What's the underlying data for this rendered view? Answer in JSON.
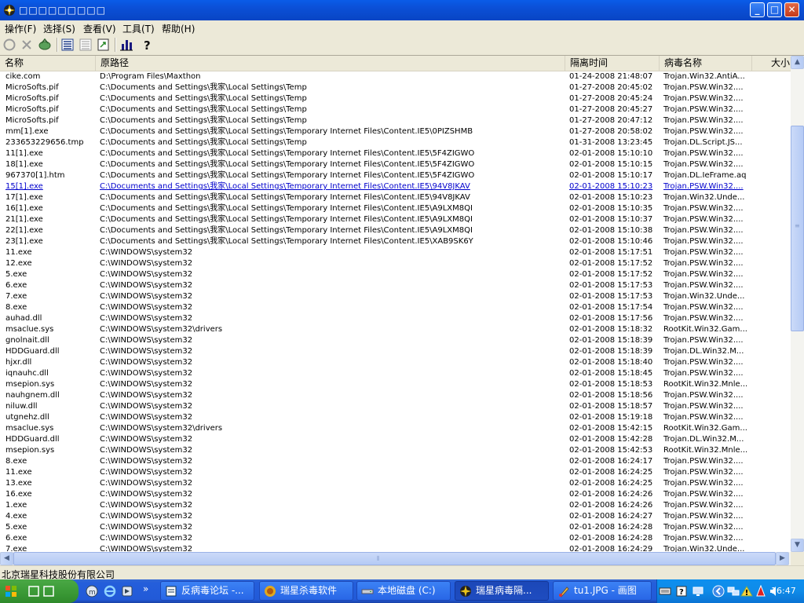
{
  "window": {
    "title": "□□□□□□□□□",
    "controls": {
      "minimize": "_",
      "maximize": "□",
      "close": "✕"
    }
  },
  "menu": [
    {
      "label": "操作(F)"
    },
    {
      "label": "选择(S)"
    },
    {
      "label": "查看(V)"
    },
    {
      "label": "工具(T)"
    },
    {
      "label": "帮助(H)"
    }
  ],
  "toolbar": {
    "icons": [
      "refresh-icon",
      "delete-icon",
      "restore-icon",
      "details-view-icon",
      "list-view-icon",
      "export-icon",
      "chart-icon",
      "help-icon"
    ]
  },
  "table": {
    "columns": [
      "名称",
      "原路径",
      "隔离时间",
      "病毒名称",
      "大小"
    ],
    "rows": [
      [
        "cike.com",
        "D:\\Program Files\\Maxthon",
        "01-24-2008 21:48:07",
        "Trojan.Win32.AntiA..."
      ],
      [
        "MicroSofts.pif",
        "C:\\Documents and Settings\\我家\\Local Settings\\Temp",
        "01-27-2008 20:45:02",
        "Trojan.PSW.Win32...."
      ],
      [
        "MicroSofts.pif",
        "C:\\Documents and Settings\\我家\\Local Settings\\Temp",
        "01-27-2008 20:45:24",
        "Trojan.PSW.Win32...."
      ],
      [
        "MicroSofts.pif",
        "C:\\Documents and Settings\\我家\\Local Settings\\Temp",
        "01-27-2008 20:45:27",
        "Trojan.PSW.Win32...."
      ],
      [
        "MicroSofts.pif",
        "C:\\Documents and Settings\\我家\\Local Settings\\Temp",
        "01-27-2008 20:47:12",
        "Trojan.PSW.Win32...."
      ],
      [
        "mm[1].exe",
        "C:\\Documents and Settings\\我家\\Local Settings\\Temporary Internet Files\\Content.IE5\\0PIZSHMB",
        "01-27-2008 20:58:02",
        "Trojan.PSW.Win32...."
      ],
      [
        "233653229656.tmp",
        "C:\\Documents and Settings\\我家\\Local Settings\\Temp",
        "01-31-2008 13:23:45",
        "Trojan.DL.Script.JS..."
      ],
      [
        "11[1].exe",
        "C:\\Documents and Settings\\我家\\Local Settings\\Temporary Internet Files\\Content.IE5\\5F4ZIGWO",
        "02-01-2008 15:10:10",
        "Trojan.PSW.Win32...."
      ],
      [
        "18[1].exe",
        "C:\\Documents and Settings\\我家\\Local Settings\\Temporary Internet Files\\Content.IE5\\5F4ZIGWO",
        "02-01-2008 15:10:15",
        "Trojan.PSW.Win32...."
      ],
      [
        "967370[1].htm",
        "C:\\Documents and Settings\\我家\\Local Settings\\Temporary Internet Files\\Content.IE5\\5F4ZIGWO",
        "02-01-2008 15:10:17",
        "Trojan.DL.IeFrame.aq"
      ],
      [
        "15[1].exe",
        "C:\\Documents and Settings\\我家\\Local Settings\\Temporary Internet Files\\Content.IE5\\94V8JKAV",
        "02-01-2008 15:10:23",
        "Trojan.PSW.Win32...."
      ],
      [
        "17[1].exe",
        "C:\\Documents and Settings\\我家\\Local Settings\\Temporary Internet Files\\Content.IE5\\94V8JKAV",
        "02-01-2008 15:10:23",
        "Trojan.Win32.Unde..."
      ],
      [
        "16[1].exe",
        "C:\\Documents and Settings\\我家\\Local Settings\\Temporary Internet Files\\Content.IE5\\A9LXM8QI",
        "02-01-2008 15:10:35",
        "Trojan.PSW.Win32...."
      ],
      [
        "21[1].exe",
        "C:\\Documents and Settings\\我家\\Local Settings\\Temporary Internet Files\\Content.IE5\\A9LXM8QI",
        "02-01-2008 15:10:37",
        "Trojan.PSW.Win32...."
      ],
      [
        "22[1].exe",
        "C:\\Documents and Settings\\我家\\Local Settings\\Temporary Internet Files\\Content.IE5\\A9LXM8QI",
        "02-01-2008 15:10:38",
        "Trojan.PSW.Win32...."
      ],
      [
        "23[1].exe",
        "C:\\Documents and Settings\\我家\\Local Settings\\Temporary Internet Files\\Content.IE5\\XAB9SK6Y",
        "02-01-2008 15:10:46",
        "Trojan.PSW.Win32...."
      ],
      [
        "11.exe",
        "C:\\WINDOWS\\system32",
        "02-01-2008 15:17:51",
        "Trojan.PSW.Win32...."
      ],
      [
        "12.exe",
        "C:\\WINDOWS\\system32",
        "02-01-2008 15:17:52",
        "Trojan.PSW.Win32...."
      ],
      [
        "5.exe",
        "C:\\WINDOWS\\system32",
        "02-01-2008 15:17:52",
        "Trojan.PSW.Win32...."
      ],
      [
        "6.exe",
        "C:\\WINDOWS\\system32",
        "02-01-2008 15:17:53",
        "Trojan.PSW.Win32...."
      ],
      [
        "7.exe",
        "C:\\WINDOWS\\system32",
        "02-01-2008 15:17:53",
        "Trojan.Win32.Unde..."
      ],
      [
        "8.exe",
        "C:\\WINDOWS\\system32",
        "02-01-2008 15:17:54",
        "Trojan.PSW.Win32...."
      ],
      [
        "auhad.dll",
        "C:\\WINDOWS\\system32",
        "02-01-2008 15:17:56",
        "Trojan.PSW.Win32...."
      ],
      [
        "msaclue.sys",
        "C:\\WINDOWS\\system32\\drivers",
        "02-01-2008 15:18:32",
        "RootKit.Win32.Gam..."
      ],
      [
        "gnolnait.dll",
        "C:\\WINDOWS\\system32",
        "02-01-2008 15:18:39",
        "Trojan.PSW.Win32...."
      ],
      [
        "HDDGuard.dll",
        "C:\\WINDOWS\\system32",
        "02-01-2008 15:18:39",
        "Trojan.DL.Win32.M..."
      ],
      [
        "hjxr.dll",
        "C:\\WINDOWS\\system32",
        "02-01-2008 15:18:40",
        "Trojan.PSW.Win32...."
      ],
      [
        "iqnauhc.dll",
        "C:\\WINDOWS\\system32",
        "02-01-2008 15:18:45",
        "Trojan.PSW.Win32...."
      ],
      [
        "msepion.sys",
        "C:\\WINDOWS\\system32",
        "02-01-2008 15:18:53",
        "RootKit.Win32.Mnle..."
      ],
      [
        "nauhgnem.dll",
        "C:\\WINDOWS\\system32",
        "02-01-2008 15:18:56",
        "Trojan.PSW.Win32...."
      ],
      [
        "niluw.dll",
        "C:\\WINDOWS\\system32",
        "02-01-2008 15:18:57",
        "Trojan.PSW.Win32...."
      ],
      [
        "utgnehz.dll",
        "C:\\WINDOWS\\system32",
        "02-01-2008 15:19:18",
        "Trojan.PSW.Win32...."
      ],
      [
        "msaclue.sys",
        "C:\\WINDOWS\\system32\\drivers",
        "02-01-2008 15:42:15",
        "RootKit.Win32.Gam..."
      ],
      [
        "HDDGuard.dll",
        "C:\\WINDOWS\\system32",
        "02-01-2008 15:42:28",
        "Trojan.DL.Win32.M..."
      ],
      [
        "msepion.sys",
        "C:\\WINDOWS\\system32",
        "02-01-2008 15:42:53",
        "RootKit.Win32.Mnle..."
      ],
      [
        "8.exe",
        "C:\\WINDOWS\\system32",
        "02-01-2008 16:24:17",
        "Trojan.PSW.Win32...."
      ],
      [
        "11.exe",
        "C:\\WINDOWS\\system32",
        "02-01-2008 16:24:25",
        "Trojan.PSW.Win32...."
      ],
      [
        "13.exe",
        "C:\\WINDOWS\\system32",
        "02-01-2008 16:24:25",
        "Trojan.PSW.Win32...."
      ],
      [
        "16.exe",
        "C:\\WINDOWS\\system32",
        "02-01-2008 16:24:26",
        "Trojan.PSW.Win32...."
      ],
      [
        "1.exe",
        "C:\\WINDOWS\\system32",
        "02-01-2008 16:24:26",
        "Trojan.PSW.Win32...."
      ],
      [
        "4.exe",
        "C:\\WINDOWS\\system32",
        "02-01-2008 16:24:27",
        "Trojan.PSW.Win32...."
      ],
      [
        "5.exe",
        "C:\\WINDOWS\\system32",
        "02-01-2008 16:24:28",
        "Trojan.PSW.Win32...."
      ],
      [
        "6.exe",
        "C:\\WINDOWS\\system32",
        "02-01-2008 16:24:28",
        "Trojan.PSW.Win32...."
      ],
      [
        "7.exe",
        "C:\\WINDOWS\\system32",
        "02-01-2008 16:24:29",
        "Trojan.Win32.Unde..."
      ]
    ],
    "selected_row": 10
  },
  "status": {
    "text": "北京瑞星科技股份有限公司"
  },
  "taskbar": {
    "start_label": "",
    "quick_launch": [
      "desktop-icon",
      "ie-icon",
      "media-icon"
    ],
    "overflow": "»",
    "tasks": [
      {
        "label": "反病毒论坛 -..."
      },
      {
        "label": "瑞星杀毒软件"
      },
      {
        "label": "本地磁盘 (C:)"
      },
      {
        "label": "瑞星病毒隔...",
        "active": true
      },
      {
        "label": "tu1.JPG - 画图"
      }
    ],
    "clock": "16:47"
  }
}
